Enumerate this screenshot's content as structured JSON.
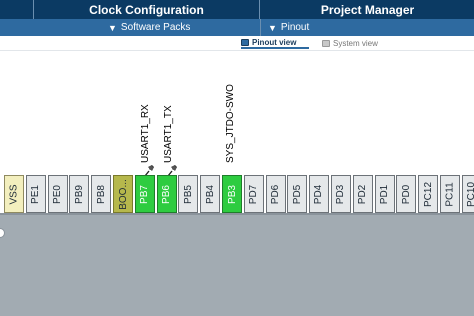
{
  "header": {
    "tabs": [
      {
        "label": "Clock Configuration"
      },
      {
        "label": "Project Manager"
      }
    ]
  },
  "subbar": {
    "items": [
      {
        "label": "Software Packs"
      },
      {
        "label": "Pinout"
      }
    ]
  },
  "views": {
    "pinout_label": "Pinout view",
    "system_label": "System view"
  },
  "pins": [
    {
      "name": "VSS",
      "state": "power"
    },
    {
      "name": "PE1",
      "state": "default"
    },
    {
      "name": "PE0",
      "state": "default"
    },
    {
      "name": "PB9",
      "state": "default"
    },
    {
      "name": "PB8",
      "state": "default"
    },
    {
      "name": "BOO...",
      "state": "boot"
    },
    {
      "name": "PB7",
      "state": "assigned"
    },
    {
      "name": "PB6",
      "state": "assigned"
    },
    {
      "name": "PB5",
      "state": "default"
    },
    {
      "name": "PB4",
      "state": "default"
    },
    {
      "name": "PB3",
      "state": "assigned"
    },
    {
      "name": "PD7",
      "state": "default"
    },
    {
      "name": "PD6",
      "state": "default"
    },
    {
      "name": "PD5",
      "state": "default"
    },
    {
      "name": "PD4",
      "state": "default"
    },
    {
      "name": "PD3",
      "state": "default"
    },
    {
      "name": "PD2",
      "state": "default"
    },
    {
      "name": "PD1",
      "state": "default"
    },
    {
      "name": "PD0",
      "state": "default"
    },
    {
      "name": "PC12",
      "state": "default"
    },
    {
      "name": "PC11",
      "state": "default"
    },
    {
      "name": "PC10",
      "state": "default"
    }
  ],
  "signals": {
    "pb7": "USART1_RX",
    "pb6": "USART1_TX",
    "pb3": "SYS_JTDO-SWO"
  },
  "colors": {
    "header_bg": "#0b3a63",
    "subbar_bg": "#2e6aa0",
    "pin_assigned": "#2ecc40",
    "pin_default": "#e5e8ea",
    "pin_power": "#f3efbe",
    "pin_boot": "#b6b84c",
    "chip_body": "#a2abb2"
  }
}
